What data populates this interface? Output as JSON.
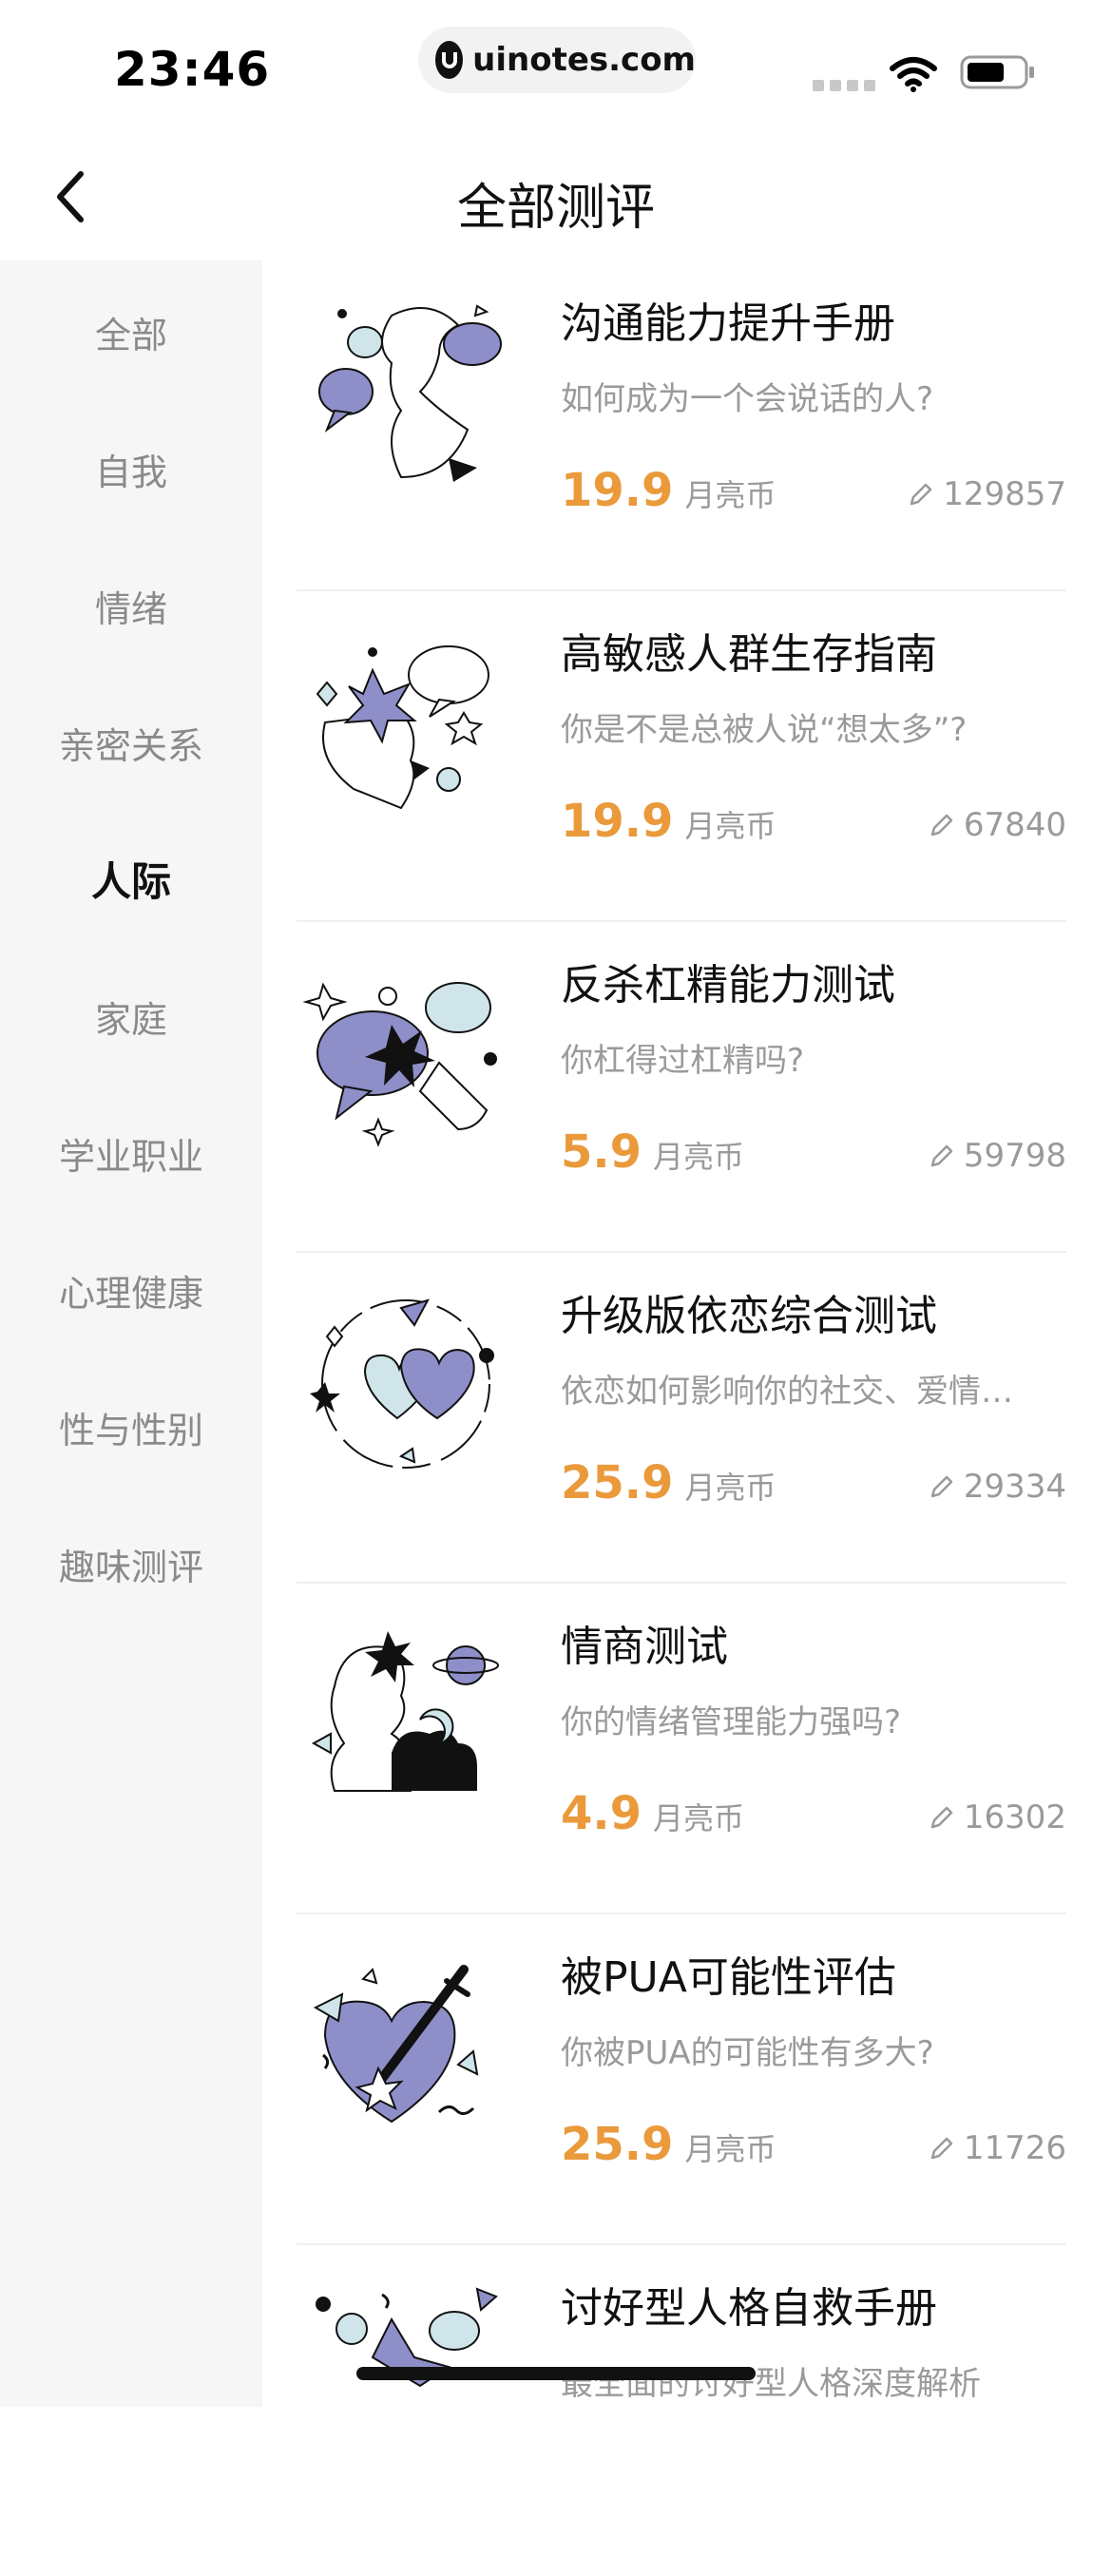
{
  "status_bar": {
    "time": "23:46",
    "url": "uinotes.com"
  },
  "header": {
    "title": "全部测评"
  },
  "sidebar": {
    "items": [
      {
        "label": "全部"
      },
      {
        "label": "自我"
      },
      {
        "label": "情绪"
      },
      {
        "label": "亲密关系"
      },
      {
        "label": "人际",
        "active": true
      },
      {
        "label": "家庭"
      },
      {
        "label": "学业职业"
      },
      {
        "label": "心理健康"
      },
      {
        "label": "性与性别"
      },
      {
        "label": "趣味测评"
      }
    ]
  },
  "list": {
    "unit_label": "月亮币",
    "items": [
      {
        "title": "沟通能力提升手册",
        "desc": "如何成为一个会说话的人?",
        "price": "19.9",
        "count": "129857",
        "icon": "communication-illustration"
      },
      {
        "title": "高敏感人群生存指南",
        "desc": "你是不是总被人说“想太多”?",
        "price": "19.9",
        "count": "67840",
        "icon": "sensitive-illustration"
      },
      {
        "title": "反杀杠精能力测试",
        "desc": "你杠得过杠精吗?",
        "price": "5.9",
        "count": "59798",
        "icon": "argue-illustration"
      },
      {
        "title": "升级版依恋综合测试",
        "desc": "依恋如何影响你的社交、爱情…",
        "price": "25.9",
        "count": "29334",
        "icon": "hearts-illustration"
      },
      {
        "title": "情商测试",
        "desc": "你的情绪管理能力强吗?",
        "price": "4.9",
        "count": "16302",
        "icon": "eq-illustration"
      },
      {
        "title": "被PUA可能性评估",
        "desc": "你被PUA的可能性有多大?",
        "price": "25.9",
        "count": "11726",
        "icon": "pua-illustration"
      },
      {
        "title": "讨好型人格自救手册",
        "desc": "最全面的讨好型人格深度解析",
        "price": "",
        "count": "",
        "icon": "pleaser-illustration"
      }
    ]
  },
  "colors": {
    "accent": "#ea9a3b",
    "illustration": "#8e8fc9",
    "light_blue": "#cfe5ea"
  }
}
